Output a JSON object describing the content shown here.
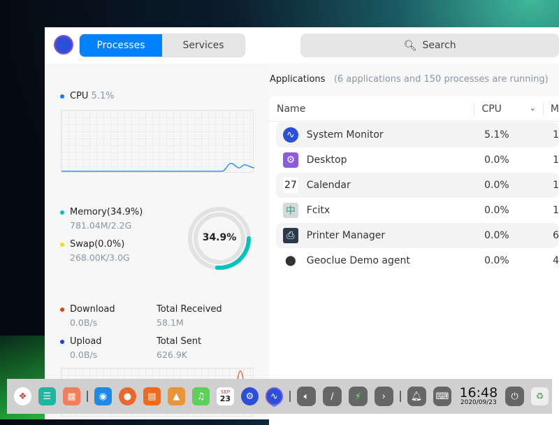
{
  "header": {
    "tabs": [
      {
        "label": "Processes",
        "active": true
      },
      {
        "label": "Services",
        "active": false
      }
    ],
    "search_placeholder": "Search"
  },
  "cpu": {
    "label": "CPU",
    "value": "5.1%",
    "color": "#0081ff"
  },
  "memory": {
    "label": "Memory(34.9%)",
    "detail": "781.04M/2.2G",
    "color": "#00c3bd",
    "percent": 34.9,
    "ring_label": "34.9%"
  },
  "swap": {
    "label": "Swap(0.0%)",
    "detail": "268.00K/3.0G",
    "color": "#fed70f",
    "percent": 0.0
  },
  "network": {
    "download_label": "Download",
    "download_value": "0.0B/s",
    "upload_label": "Upload",
    "upload_value": "0.0B/s",
    "received_label": "Total Received",
    "received_value": "58.1M",
    "sent_label": "Total Sent",
    "sent_value": "626.9K",
    "download_color": "#e14300",
    "upload_color": "#1245e6"
  },
  "apps": {
    "title": "Applications",
    "summary": "(6 applications and 150 processes are running)",
    "columns": [
      "Name",
      "CPU",
      "M"
    ],
    "rows": [
      {
        "name": "System Monitor",
        "cpu": "5.1%",
        "mem": "1",
        "icon": "system-monitor-icon"
      },
      {
        "name": "Desktop",
        "cpu": "0.0%",
        "mem": "1",
        "icon": "desktop-settings-icon"
      },
      {
        "name": "Calendar",
        "cpu": "0.0%",
        "mem": "1",
        "icon": "calendar-icon"
      },
      {
        "name": "Fcitx",
        "cpu": "0.0%",
        "mem": "1",
        "icon": "keyboard-input-icon"
      },
      {
        "name": "Printer Manager",
        "cpu": "0.0%",
        "mem": "6",
        "icon": "printer-icon"
      },
      {
        "name": "Geoclue Demo agent",
        "cpu": "0.0%",
        "mem": "4",
        "icon": "location-pin-icon"
      }
    ]
  },
  "dock": {
    "calendar_month": "SEP",
    "calendar_day": "23",
    "time": "16:48",
    "date": "2020/09/23"
  }
}
